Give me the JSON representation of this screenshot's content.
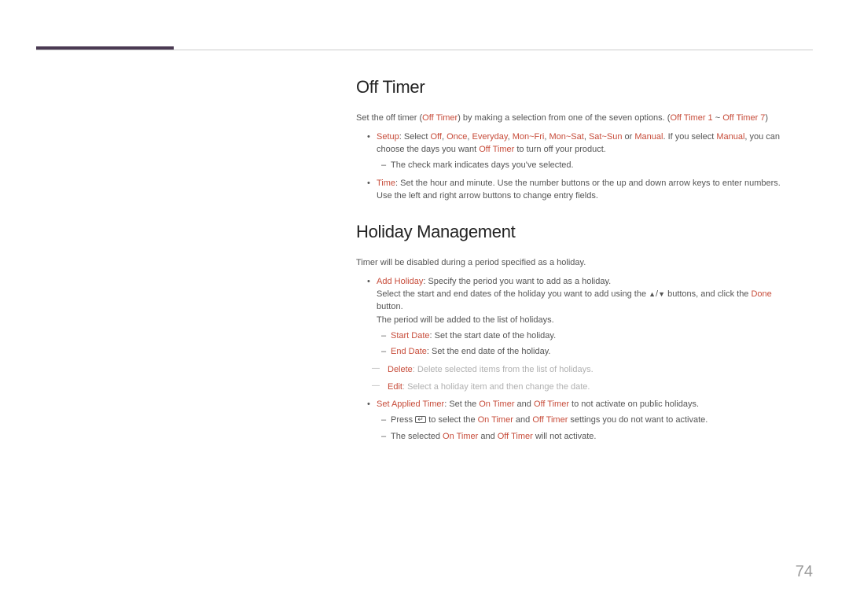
{
  "page_number": "74",
  "sec1": {
    "heading": "Off Timer",
    "intro_pre": "Set the off timer (",
    "intro_off_timer": "Off Timer",
    "intro_mid": ") by making a selection from one of the seven options. (",
    "intro_ot1": "Off Timer 1",
    "intro_tilde": " ~ ",
    "intro_ot7": "Off Timer 7",
    "intro_post": ")",
    "setup_label": "Setup",
    "setup_pre": ": Select ",
    "setup_off": "Off",
    "setup_comma1": ", ",
    "setup_once": "Once",
    "setup_comma2": ", ",
    "setup_everyday": "Everyday",
    "setup_comma3": ", ",
    "setup_monfri": "Mon~Fri",
    "setup_comma4": ", ",
    "setup_monsat": "Mon~Sat",
    "setup_comma5": ", ",
    "setup_satsun": "Sat~Sun",
    "setup_or": " or ",
    "setup_manual": "Manual",
    "setup_post1": ". If you select ",
    "setup_manual2": "Manual",
    "setup_post2": ", you can choose the days you want ",
    "setup_offtimer2": "Off Timer",
    "setup_post3": " to turn off your product.",
    "setup_dash1": "The check mark indicates days you've selected.",
    "time_label": "Time",
    "time_text": ": Set the hour and minute. Use the number buttons or the up and down arrow keys to enter numbers. Use the left and right arrow buttons to change entry fields."
  },
  "sec2": {
    "heading": "Holiday Management",
    "intro": "Timer will be disabled during a period specified as a holiday.",
    "add_label": "Add Holiday",
    "add_text": ": Specify the period you want to add as a holiday.",
    "add_line2_pre": "Select the start and end dates of the holiday you want to add using the ",
    "add_line2_mid": " buttons, and click the ",
    "add_done": "Done",
    "add_line2_post": " button.",
    "add_line3": "The period will be added to the list of holidays.",
    "start_label": "Start Date",
    "start_text": ": Set the start date of the holiday.",
    "end_label": "End Date",
    "end_text": ": Set the end date of the holiday.",
    "delete_label": "Delete",
    "delete_text": ": Delete selected items from the list of holidays.",
    "edit_label": "Edit",
    "edit_text": ": Select a holiday item and then change the date.",
    "sat_label": "Set Applied Timer",
    "sat_pre": ": Set the ",
    "sat_on": "On Timer",
    "sat_and": " and ",
    "sat_off": "Off Timer",
    "sat_post": " to not activate on public holidays.",
    "sat_d1_pre": "Press ",
    "sat_d1_mid": " to select the ",
    "sat_d1_on": "On Timer",
    "sat_d1_and": " and ",
    "sat_d1_off": "Off Timer",
    "sat_d1_post": " settings you do not want to activate.",
    "sat_d2_pre": "The selected ",
    "sat_d2_on": "On Timer",
    "sat_d2_and": " and ",
    "sat_d2_off": "Off Timer",
    "sat_d2_post": " will not activate."
  }
}
